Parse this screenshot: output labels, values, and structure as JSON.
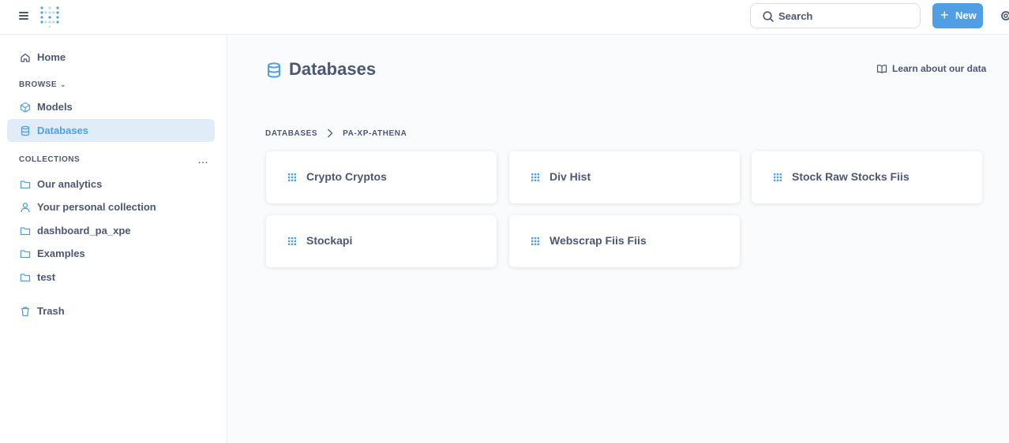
{
  "topbar": {
    "search_label": "Search",
    "new_label": "New",
    "new_icon": "+",
    "accent": "#509ee3"
  },
  "sidebar": {
    "home": "Home",
    "browse_heading": "BROWSE",
    "browse_items": [
      {
        "label": "Models",
        "icon": "cube-icon"
      },
      {
        "label": "Databases",
        "icon": "database-icon",
        "active": true
      }
    ],
    "collections_heading": "COLLECTIONS",
    "collections_more": "…",
    "collections": [
      {
        "label": "Our analytics",
        "icon": "folder-icon"
      },
      {
        "label": "Your personal collection",
        "icon": "person-icon"
      },
      {
        "label": "dashboard_pa_xpe",
        "icon": "folder-icon"
      },
      {
        "label": "Examples",
        "icon": "folder-icon"
      },
      {
        "label": "test",
        "icon": "folder-icon"
      }
    ],
    "trash": "Trash"
  },
  "main": {
    "title": "Databases",
    "learn_link": "Learn about our data",
    "breadcrumbs": [
      "DATABASES",
      "PA-XP-ATHENA"
    ],
    "tables": [
      "Crypto Cryptos",
      "Div Hist",
      "Stock Raw Stocks Fiis",
      "Stockapi",
      "Webscrap Fiis Fiis"
    ]
  }
}
